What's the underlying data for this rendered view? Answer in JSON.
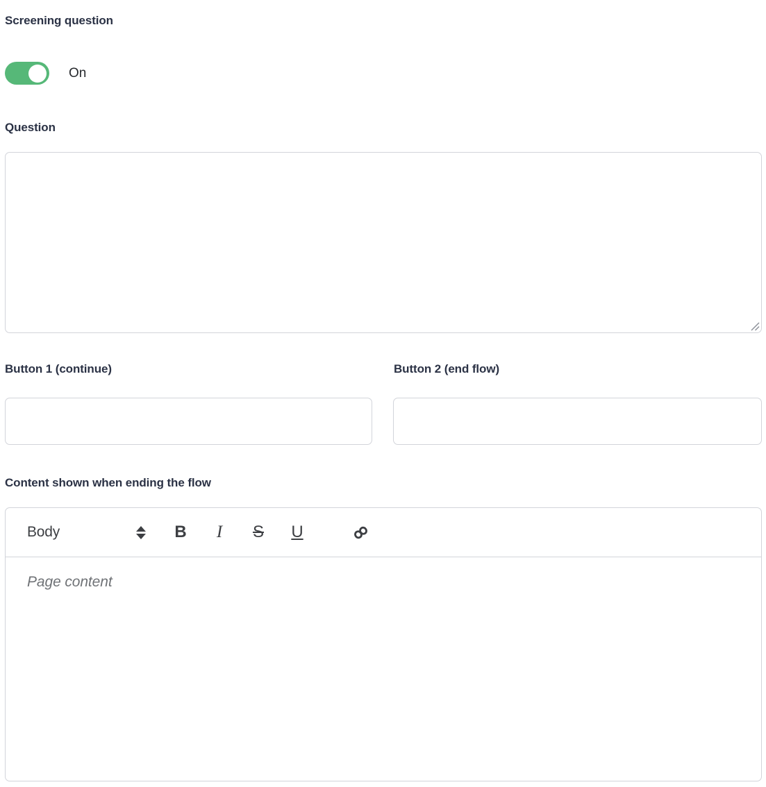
{
  "section": {
    "heading": "Screening question"
  },
  "toggle": {
    "state_label": "On",
    "enabled": true,
    "on_color": "#56b878",
    "knob_color": "#ffffff"
  },
  "question": {
    "label": "Question",
    "value": "",
    "placeholder": ""
  },
  "buttons": {
    "button1": {
      "label": "Button 1 (continue)",
      "value": "",
      "placeholder": ""
    },
    "button2": {
      "label": "Button 2 (end flow)",
      "value": "",
      "placeholder": ""
    }
  },
  "editor": {
    "label": "Content shown when ending the flow",
    "toolbar": {
      "style_select": {
        "value": "Body",
        "icon": "stepper-updown-icon"
      },
      "bold": {
        "glyph": "B",
        "icon": "bold-icon"
      },
      "italic": {
        "glyph": "I",
        "icon": "italic-icon"
      },
      "strikethrough": {
        "glyph": "S",
        "icon": "strikethrough-icon"
      },
      "underline": {
        "glyph": "U",
        "icon": "underline-icon"
      },
      "link": {
        "icon": "link-icon"
      }
    },
    "content": "",
    "placeholder": "Page content"
  },
  "colors": {
    "label_text": "#2b3245",
    "border": "#d2d4da",
    "toolbar_icon": "#3d3f43",
    "placeholder_text": "#6f7276",
    "accent_green": "#56b878"
  }
}
